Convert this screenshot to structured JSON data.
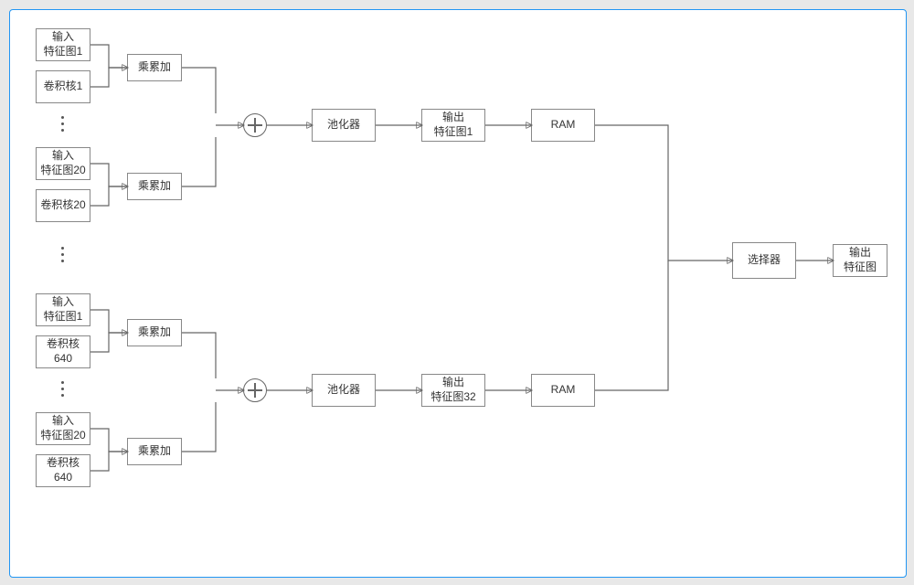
{
  "top": {
    "group1": {
      "input": "输入\n特征图1",
      "kernel": "卷积核1",
      "mac": "乘累加"
    },
    "group20": {
      "input": "输入\n特征图20",
      "kernel": "卷积核20",
      "mac": "乘累加"
    },
    "pool": "池化器",
    "out": "输出\n特征图1",
    "ram": "RAM"
  },
  "bottom": {
    "group1": {
      "input": "输入\n特征图1",
      "kernel": "卷积核\n640",
      "mac": "乘累加"
    },
    "group20": {
      "input": "输入\n特征图20",
      "kernel": "卷积核\n640",
      "mac": "乘累加"
    },
    "pool": "池化器",
    "out": "输出\n特征图32",
    "ram": "RAM"
  },
  "selector": "选择器",
  "final_out": "输出\n特征图"
}
